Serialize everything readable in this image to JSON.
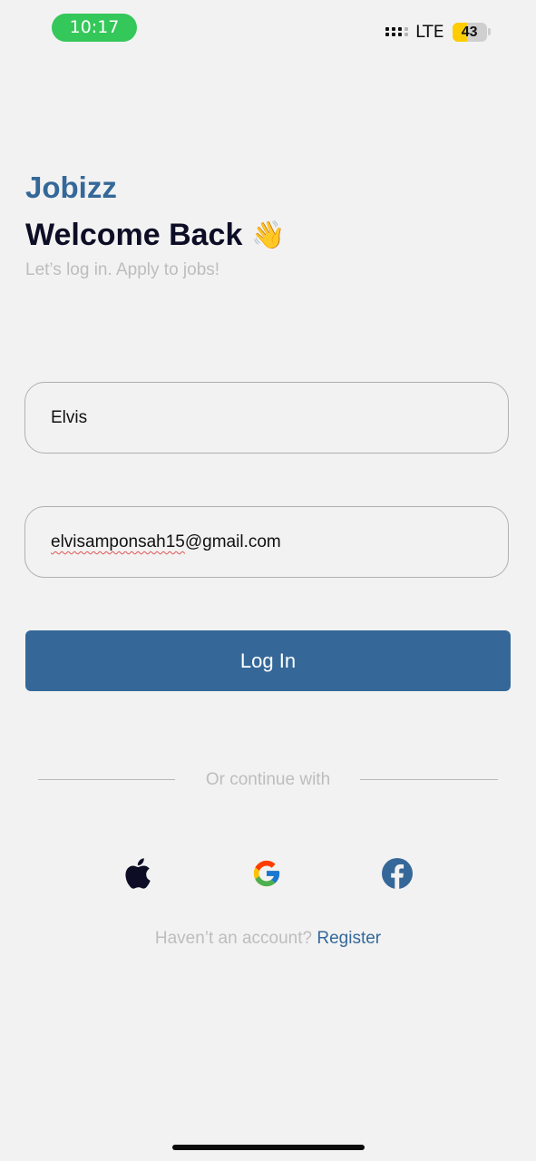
{
  "status_bar": {
    "time": "10:17",
    "network": "LTE",
    "battery_level": 43,
    "battery_label": "43",
    "battery_color": "#ffcc00",
    "time_pill_color": "#34c759"
  },
  "header": {
    "brand": "Jobizz",
    "title": "Welcome Back",
    "wave_emoji": "👋",
    "subtitle": "Let’s log in. Apply to jobs!"
  },
  "form": {
    "name_value": "Elvis",
    "email_misspelled_part": "elvisamponsah15",
    "email_domain_part": "@gmail.com",
    "login_label": "Log In"
  },
  "social": {
    "divider_text": "Or continue with",
    "providers": [
      "apple-icon",
      "google-icon",
      "facebook-icon"
    ]
  },
  "footer": {
    "prompt": "Haven’t an account?",
    "register_label": "Register"
  },
  "colors": {
    "brand": "#356899",
    "heading": "#0d0d26",
    "muted": "#bdbdbd",
    "background": "#f2f2f2"
  }
}
